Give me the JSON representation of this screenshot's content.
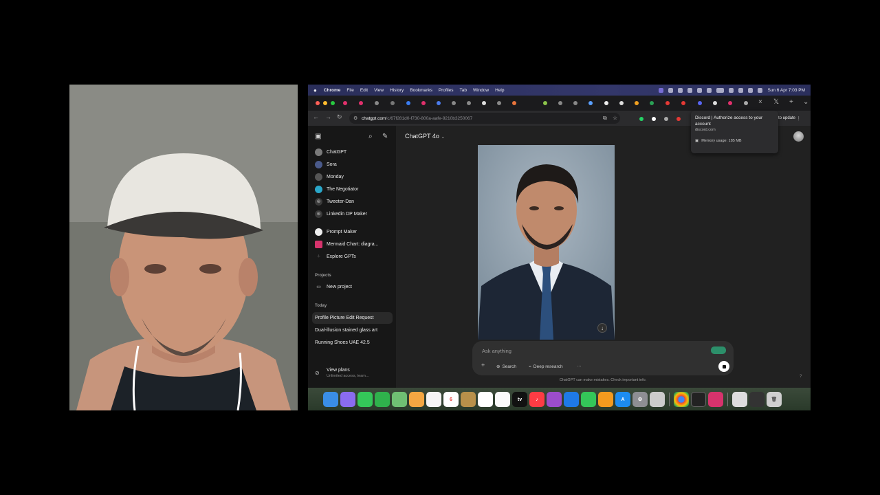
{
  "menubar": {
    "apple": "",
    "items": [
      "Chrome",
      "File",
      "Edit",
      "View",
      "History",
      "Bookmarks",
      "Profiles",
      "Tab",
      "Window",
      "Help"
    ],
    "clock": "Sun 6 Apr  7:03 PM"
  },
  "browser": {
    "url_host": "chatgpt.com",
    "url_path": "/c/67f281d0-f730-800a-aafe-9210b3250067",
    "update_label": "to update"
  },
  "tooltip": {
    "title": "Discord | Authorize access to your account",
    "domain": "discord.com",
    "memory": "Memory usage: 185 MB"
  },
  "sidebar": {
    "gpts": [
      {
        "label": "ChatGPT",
        "color": "#7a7a7a"
      },
      {
        "label": "Sora",
        "color": "#4a5a8a"
      },
      {
        "label": "Monday",
        "color": "#555555"
      },
      {
        "label": "The Negotiator",
        "color": "#2aa7c9"
      },
      {
        "label": "Tweeter-Dan",
        "color": "#444444"
      },
      {
        "label": "Linkedin DP Maker",
        "color": "#444444"
      },
      {
        "label": "Prompt Maker",
        "color": "#eeeeee"
      },
      {
        "label": "Mermaid Chart: diagra...",
        "color": "#d6336c"
      },
      {
        "label": "Explore GPTs",
        "color": "#333333"
      }
    ],
    "projects_heading": "Projects",
    "new_project": "New project",
    "today_heading": "Today",
    "chats": [
      "Profile Picture Edit Request",
      "Dual-illusion stained glass art",
      "Running Shoes UAE 42.5"
    ],
    "view_plans": "View plans",
    "view_plans_sub": "Unlimited access, team..."
  },
  "main": {
    "model": "ChatGPT 4o",
    "share": "are",
    "composer_placeholder": "Ask anything",
    "search_label": "Search",
    "deep_research_label": "Deep research",
    "more_label": "···",
    "plus_label": "+",
    "disclaimer": "ChatGPT can make mistakes. Check important info.",
    "help": "?"
  },
  "colors": {
    "sidebar_bg": "#171717",
    "main_bg": "#212121",
    "composer_bg": "#303030",
    "menubar_bg": "#2a2e5a"
  }
}
